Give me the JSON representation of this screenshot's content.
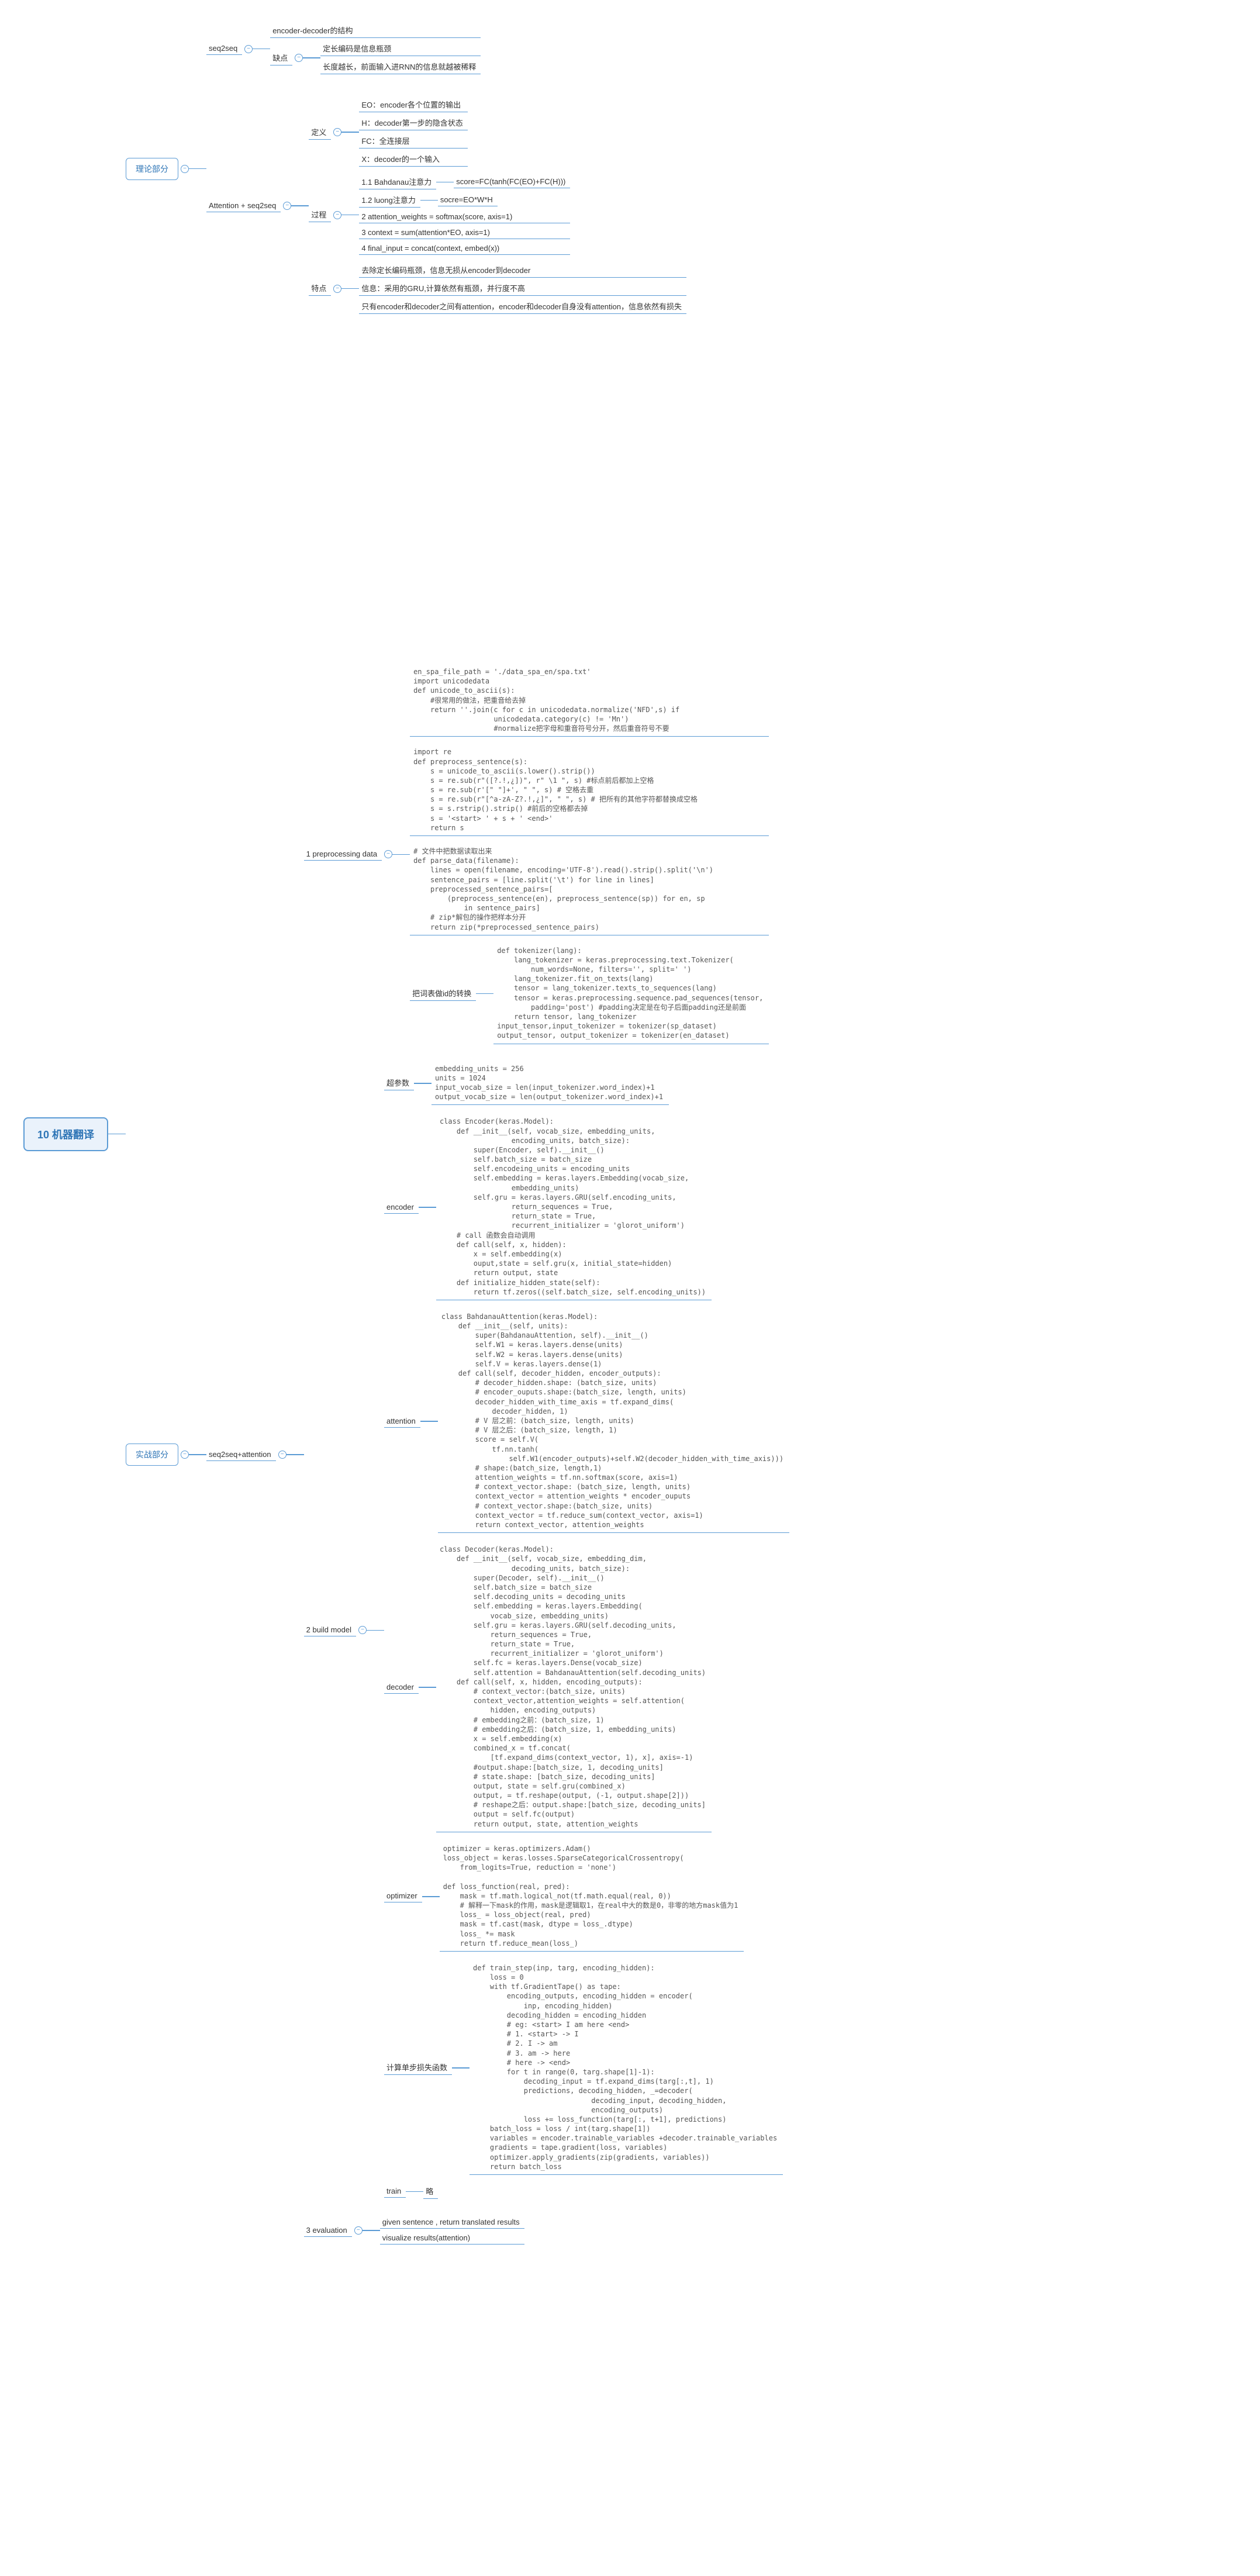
{
  "root": "10 机器翻译",
  "theory": {
    "label": "理论部分",
    "seq2seq": {
      "label": "seq2seq",
      "item1": "encoder-decoder的结构",
      "defect_label": "缺点",
      "defect1": "定长编码是信息瓶颈",
      "defect2": "长度越长，前面输入进RNN的信息就越被稀释"
    },
    "attention": {
      "label": "Attention + seq2seq",
      "define_label": "定义",
      "define": {
        "d1": "EO：encoder各个位置的输出",
        "d2": "H：decoder第一步的隐含状态",
        "d3": "FC：全连接层",
        "d4": "X：decoder的一个输入"
      },
      "process_label": "过程",
      "process": {
        "p1": {
          "label": "1.1 Bahdanau注意力",
          "val": "score=FC(tanh(FC(EO)+FC(H)))"
        },
        "p1b": {
          "label": "1.2 luong注意力",
          "val": "socre=EO*W*H"
        },
        "p2": "2 attention_weights = softmax(score, axis=1)",
        "p3": "3 context = sum(attention*EO, axis=1)",
        "p4": "4 final_input = concat(context, embed(x))"
      },
      "feature_label": "特点",
      "feature": {
        "f1": "去除定长编码瓶颈，信息无损从encoder到decoder",
        "f2": "信息：采用的GRU,计算依然有瓶颈，并行度不高",
        "f3": "只有encoder和decoder之间有attention，encoder和decoder自身没有attention，信息依然有损失"
      }
    }
  },
  "practice": {
    "label": "实战部分",
    "s2s_att": "seq2seq+attention",
    "preprocess": {
      "label": "1 preprocessing data",
      "code1": "en_spa_file_path = './data_spa_en/spa.txt'\nimport unicodedata\ndef unicode_to_ascii(s):\n    #很常用的做法，把重音给去掉\n    return ''.join(c for c in unicodedata.normalize('NFD',s) if\n                   unicodedata.category(c) != 'Mn')\n                   #normalize把字母和重音符号分开，然后重音符号不要",
      "code2": "import re\ndef preprocess_sentence(s):\n    s = unicode_to_ascii(s.lower().strip())\n    s = re.sub(r\"([?.!,¿])\", r\" \\1 \", s) #标点前后都加上空格\n    s = re.sub(r'[\" \"]+', \" \", s) # 空格去重\n    s = re.sub(r\"[^a-zA-Z?.!,¿]\", \" \", s) # 把所有的其他字符都替换成空格\n    s = s.rstrip().strip() #前后的空格都去掉\n    s = '<start> ' + s + ' <end>'\n    return s",
      "code3": "# 文件中把数据读取出来\ndef parse_data(filename):\n    lines = open(filename, encoding='UTF-8').read().strip().split('\\n')\n    sentence_pairs = [line.split('\\t') for line in lines]\n    preprocessed_sentence_pairs=[\n        (preprocess_sentence(en), preprocess_sentence(sp)) for en, sp\n            in sentence_pairs]\n    # zip*解包的操作把样本分开\n    return zip(*preprocessed_sentence_pairs)",
      "tokenizer_label": "把词表做id的转换",
      "code4": "def tokenizer(lang):\n    lang_tokenizer = keras.preprocessing.text.Tokenizer(\n        num_words=None, filters='', split=' ')\n    lang_tokenizer.fit_on_texts(lang)\n    tensor = lang_tokenizer.texts_to_sequences(lang)\n    tensor = keras.preprocessing.sequence.pad_sequences(tensor,\n        padding='post') #padding决定是在句子后面padding还是前面\n    return tensor, lang_tokenizer\ninput_tensor,input_tokenizer = tokenizer(sp_dataset)\noutput_tensor, output_tokenizer = tokenizer(en_dataset)"
    },
    "build": {
      "label": "2 build model",
      "hyper_label": "超参数",
      "hyper_code": "embedding_units = 256\nunits = 1024\ninput_vocab_size = len(input_tokenizer.word_index)+1\noutput_vocab_size = len(output_tokenizer.word_index)+1",
      "encoder_label": "encoder",
      "encoder_code": "class Encoder(keras.Model):\n    def __init__(self, vocab_size, embedding_units,\n                 encoding_units, batch_size):\n        super(Encoder, self).__init__()\n        self.batch_size = batch_size\n        self.encodeing_units = encoding_units\n        self.embedding = keras.layers.Embedding(vocab_size,\n                 embedding_units)\n        self.gru = keras.layers.GRU(self.encoding_units,\n                 return_sequences = True,\n                 return_state = True,\n                 recurrent_initializer = 'glorot_uniform')\n    # call 函数会自动调用\n    def call(self, x, hidden):\n        x = self.embedding(x)\n        ouput,state = self.gru(x, initial_state=hidden)\n        return output, state\n    def initialize_hidden_state(self):\n        return tf.zeros((self.batch_size, self.encoding_units))",
      "attention_label": "attention",
      "attention_code": "class BahdanauAttention(keras.Model):\n    def __init__(self, units):\n        super(BahdanauAttention, self).__init__()\n        self.W1 = keras.layers.dense(units)\n        self.W2 = keras.layers.dense(units)\n        self.V = keras.layers.dense(1)\n    def call(self, decoder_hidden, encoder_outputs):\n        # decoder_hidden.shape: (batch_size, units)\n        # encoder_ouputs.shape:(batch_size, length, units)\n        decoder_hidden_with_time_axis = tf.expand_dims(\n            decoder_hidden, 1)\n        # V 层之前：(batch_size, length, units)\n        # V 层之后：(batch_size, length, 1)\n        score = self.V(\n            tf.nn.tanh(\n                self.W1(encoder_outputs)+self.W2(decoder_hidden_with_time_axis)))\n        # shape:(batch_size, length,1)\n        attention_weights = tf.nn.softmax(score, axis=1)\n        # context_vector.shape: (batch_size, length, units)\n        context_vector = attention_weights * encoder_ouputs\n        # context_vector.shape:(batch_size, units)\n        context_vector = tf.reduce_sum(context_vector, axis=1)\n        return context_vector, attention_weights",
      "decoder_label": "decoder",
      "decoder_code": "class Decoder(keras.Model):\n    def __init__(self, vocab_size, embedding_dim,\n                 decoding_units, batch_size):\n        super(Decoder, self).__init__()\n        self.batch_size = batch_size\n        self.decoding_units = decoding_units\n        self.embedding = keras.layers.Embedding(\n            vocab_size, embedding_units)\n        self.gru = keras.layers.GRU(self.decoding_units,\n            return_sequences = True,\n            return_state = True,\n            recurrent_initializer = 'glorot_uniform')\n        self.fc = keras.layers.Dense(vocab_size)\n        self.attention = BahdanauAttention(self.decoding_units)\n    def call(self, x, hidden, encoding_outputs):\n        # context_vector:(batch_size, units)\n        context_vector,attention_weights = self.attention(\n            hidden, encoding_outputs)\n        # embedding之前：(batch_size, 1)\n        # embedding之后：(batch_size, 1, embedding_units)\n        x = self.embedding(x)\n        combined_x = tf.concat(\n            [tf.expand_dims(context_vector, 1), x], axis=-1)\n        #output.shape:[batch_size, 1, decoding_units]\n        # state.shape: [batch_size, decoding_units]\n        output, state = self.gru(combined_x)\n        output, = tf.reshape(output, (-1, output.shape[2]))\n        # reshape之后：output.shape:[batch_size, decoding_units]\n        output = self.fc(output)\n        return output, state, attention_weights",
      "optimizer_label": "optimizer",
      "optimizer_code": "optimizer = keras.optimizers.Adam()\nloss_object = keras.losses.SparseCategoricalCrossentropy(\n    from_logits=True, reduction = 'none')\n\ndef loss_function(real, pred):\n    mask = tf.math.logical_not(tf.math.equal(real, 0))\n    # 解释一下mask的作用，mask是逻辑取1，在real中大的数是0，非零的地方mask值为1\n    loss_ = loss_object(real, pred)\n    mask = tf.cast(mask, dtype = loss_.dtype)\n    loss_ *= mask\n    return tf.reduce_mean(loss_)",
      "loss_label": "计算单步损失函数",
      "loss_code": "def train_step(inp, targ, encoding_hidden):\n    loss = 0\n    with tf.GradientTape() as tape:\n        encoding_outputs, encoding_hidden = encoder(\n            inp, encoding_hidden)\n        decoding_hidden = encoding_hidden\n        # eg: <start> I am here <end>\n        # 1. <start> -> I\n        # 2. I -> am\n        # 3. am -> here\n        # here -> <end>\n        for t in range(0, targ.shape[1]-1):\n            decoding_input = tf.expand_dims(targ[:,t], 1)\n            predictions, decoding_hidden, _=decoder(\n                            decoding_input, decoding_hidden,\n                            encoding_outputs)\n            loss += loss_function(targ[:, t+1], predictions)\n    batch_loss = loss / int(targ.shape[1])\n    variables = encoder.trainable_variables +decoder.trainable_variables\n    gradients = tape.gradient(loss, variables)\n    optimizer.apply_gradients(zip(gradients, variables))\n    return batch_loss",
      "train_label": "train",
      "train_val": "略"
    },
    "eval": {
      "label": "3 evaluation",
      "e1": "given sentence , return translated results",
      "e2": "visualize results(attention)"
    }
  }
}
